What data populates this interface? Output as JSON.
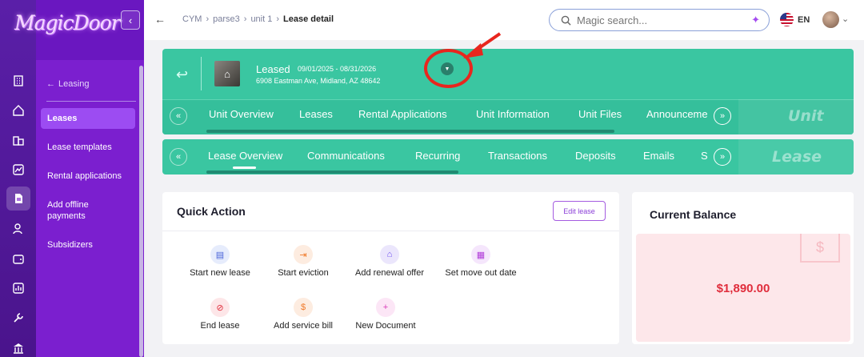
{
  "app": {
    "logo_text": "MagicDoor"
  },
  "rail": {
    "icons": [
      "buildings-icon",
      "home-icon",
      "property-icon",
      "chart-icon",
      "lease-doc-icon",
      "people-icon",
      "wallet-icon",
      "report-icon",
      "tools-icon",
      "bank-icon"
    ],
    "active_index": 4
  },
  "submenu": {
    "back_label": "Leasing",
    "items": [
      {
        "label": "Leases",
        "active": true
      },
      {
        "label": "Lease templates",
        "active": false
      },
      {
        "label": "Rental applications",
        "active": false
      },
      {
        "label": "Add offline payments",
        "active": false
      },
      {
        "label": "Subsidizers",
        "active": false
      }
    ]
  },
  "header": {
    "breadcrumbs": [
      "CYM",
      "parse3",
      "unit 1",
      "Lease detail"
    ],
    "search_placeholder": "Magic search...",
    "language": "EN"
  },
  "lease": {
    "status": "Leased",
    "dates": "09/01/2025 - 08/31/2026",
    "address": "6908 Eastman Ave, Midland, AZ 48642"
  },
  "unit_tabs": {
    "items": [
      "Unit Overview",
      "Leases",
      "Rental Applications",
      "Unit Information",
      "Unit Files",
      "Announceme"
    ],
    "badge": "Unit"
  },
  "lease_tabs": {
    "items": [
      "Lease Overview",
      "Communications",
      "Recurring",
      "Transactions",
      "Deposits",
      "Emails",
      "S"
    ],
    "active_index": 0,
    "badge": "Lease"
  },
  "quick_action": {
    "title": "Quick Action",
    "edit_label": "Edit lease",
    "actions": [
      {
        "label": "Start new lease",
        "icon": "new-lease-icon",
        "color": "#4a63d8"
      },
      {
        "label": "Start eviction",
        "icon": "eviction-icon",
        "color": "#f07a2a"
      },
      {
        "label": "Add renewal offer",
        "icon": "renewal-icon",
        "color": "#6a4cf0"
      },
      {
        "label": "Set move out date",
        "icon": "calendar-icon",
        "color": "#b03ad8"
      },
      {
        "label": "End lease",
        "icon": "end-lease-icon",
        "color": "#e02d3c"
      },
      {
        "label": "Add service bill",
        "icon": "service-bill-icon",
        "color": "#f07a2a"
      },
      {
        "label": "New Document",
        "icon": "new-document-icon",
        "color": "#d83ab8"
      }
    ]
  },
  "balance": {
    "title": "Current Balance",
    "amount": "$1,890.00"
  },
  "colors": {
    "brand_purple": "#7b1fcf",
    "teal": "#3ac6a1",
    "annotation_red": "#e8261e"
  }
}
